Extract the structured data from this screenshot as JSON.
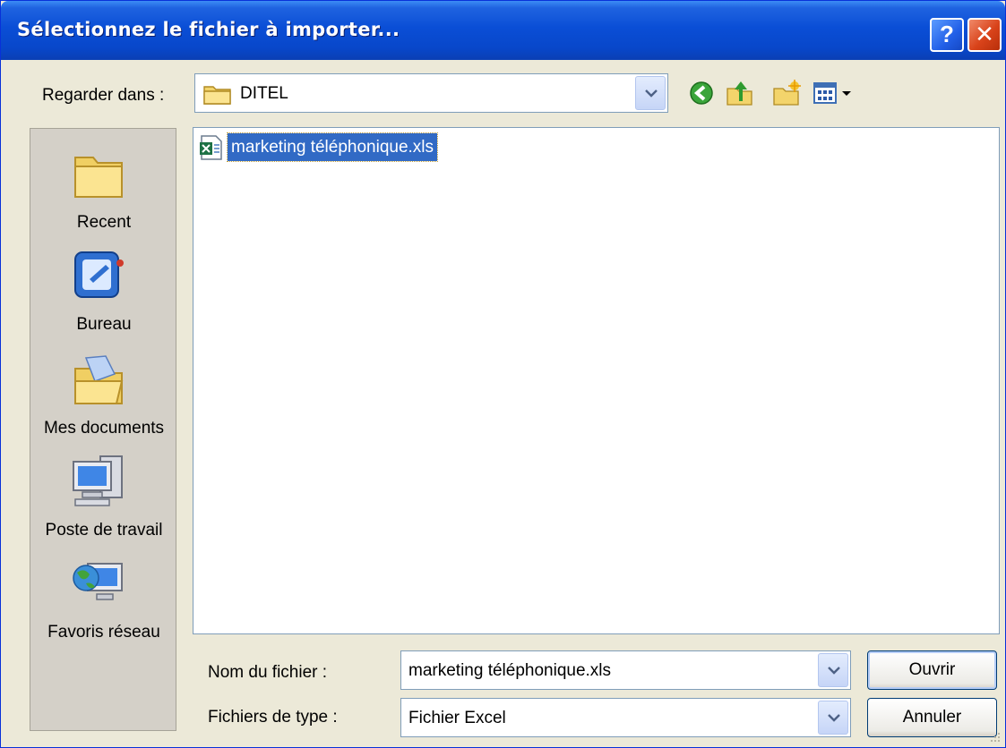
{
  "window": {
    "title": "Sélectionnez le fichier à importer...",
    "help_glyph": "?",
    "close_glyph": "✕"
  },
  "lookin": {
    "label": "Regarder dans :",
    "value": "DITEL"
  },
  "places": [
    {
      "label": "Recent",
      "icon": "recent-folder-icon"
    },
    {
      "label": "Bureau",
      "icon": "desktop-icon"
    },
    {
      "label": "Mes documents",
      "icon": "my-documents-icon"
    },
    {
      "label": "Poste de travail",
      "icon": "my-computer-icon"
    },
    {
      "label": "Favoris réseau",
      "icon": "network-places-icon"
    }
  ],
  "files": [
    {
      "name": "marketing téléphonique.xls",
      "icon": "excel-file-icon",
      "selected": true
    }
  ],
  "filename": {
    "label": "Nom du fichier :",
    "value": "marketing téléphonique.xls"
  },
  "filetype": {
    "label": "Fichiers de type :",
    "value": "Fichier Excel"
  },
  "buttons": {
    "open": "Ouvrir",
    "cancel": "Annuler"
  },
  "colors": {
    "title_bar": "#0a4ed6",
    "selection": "#316ac5",
    "dialog_bg": "#ece9d8",
    "places_bg": "#d4d0c8"
  }
}
